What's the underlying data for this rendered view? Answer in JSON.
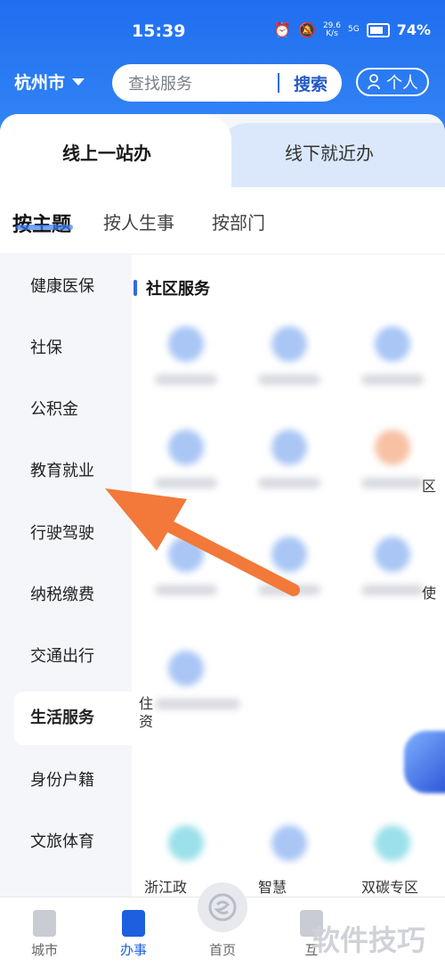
{
  "status": {
    "time": "15:39",
    "net_speed_top": "29.6",
    "net_speed_bottom": "K/s",
    "signal": "5G",
    "battery": "74%"
  },
  "header": {
    "city": "杭州市",
    "search_placeholder": "查找服务",
    "search_button": "搜索",
    "profile_button": "个人"
  },
  "tabs": {
    "online": "线上一站办",
    "offline": "线下就近办"
  },
  "subtabs": [
    "按主题",
    "按人生事",
    "按部门"
  ],
  "sidebar": {
    "items": [
      "健康医保",
      "社保",
      "公积金",
      "教育就业",
      "行驶驾驶",
      "纳税缴费",
      "交通出行",
      "生活服务",
      "身份户籍",
      "文旅体育"
    ],
    "active_index": 7
  },
  "panel": {
    "section_title": "社区服务",
    "edge_chars": [
      "区",
      "使",
      "住",
      "资"
    ],
    "bottom_labels": [
      "浙江政",
      "智慧",
      "双碳专区"
    ]
  },
  "bottom_nav": {
    "items": [
      "城市",
      "办事",
      "首页",
      "互"
    ],
    "active_index": 1
  },
  "watermark": "软件技巧",
  "colors": {
    "primary": "#1f6ef0",
    "active_text": "#1d5fe0",
    "annotation": "#f2793a"
  }
}
